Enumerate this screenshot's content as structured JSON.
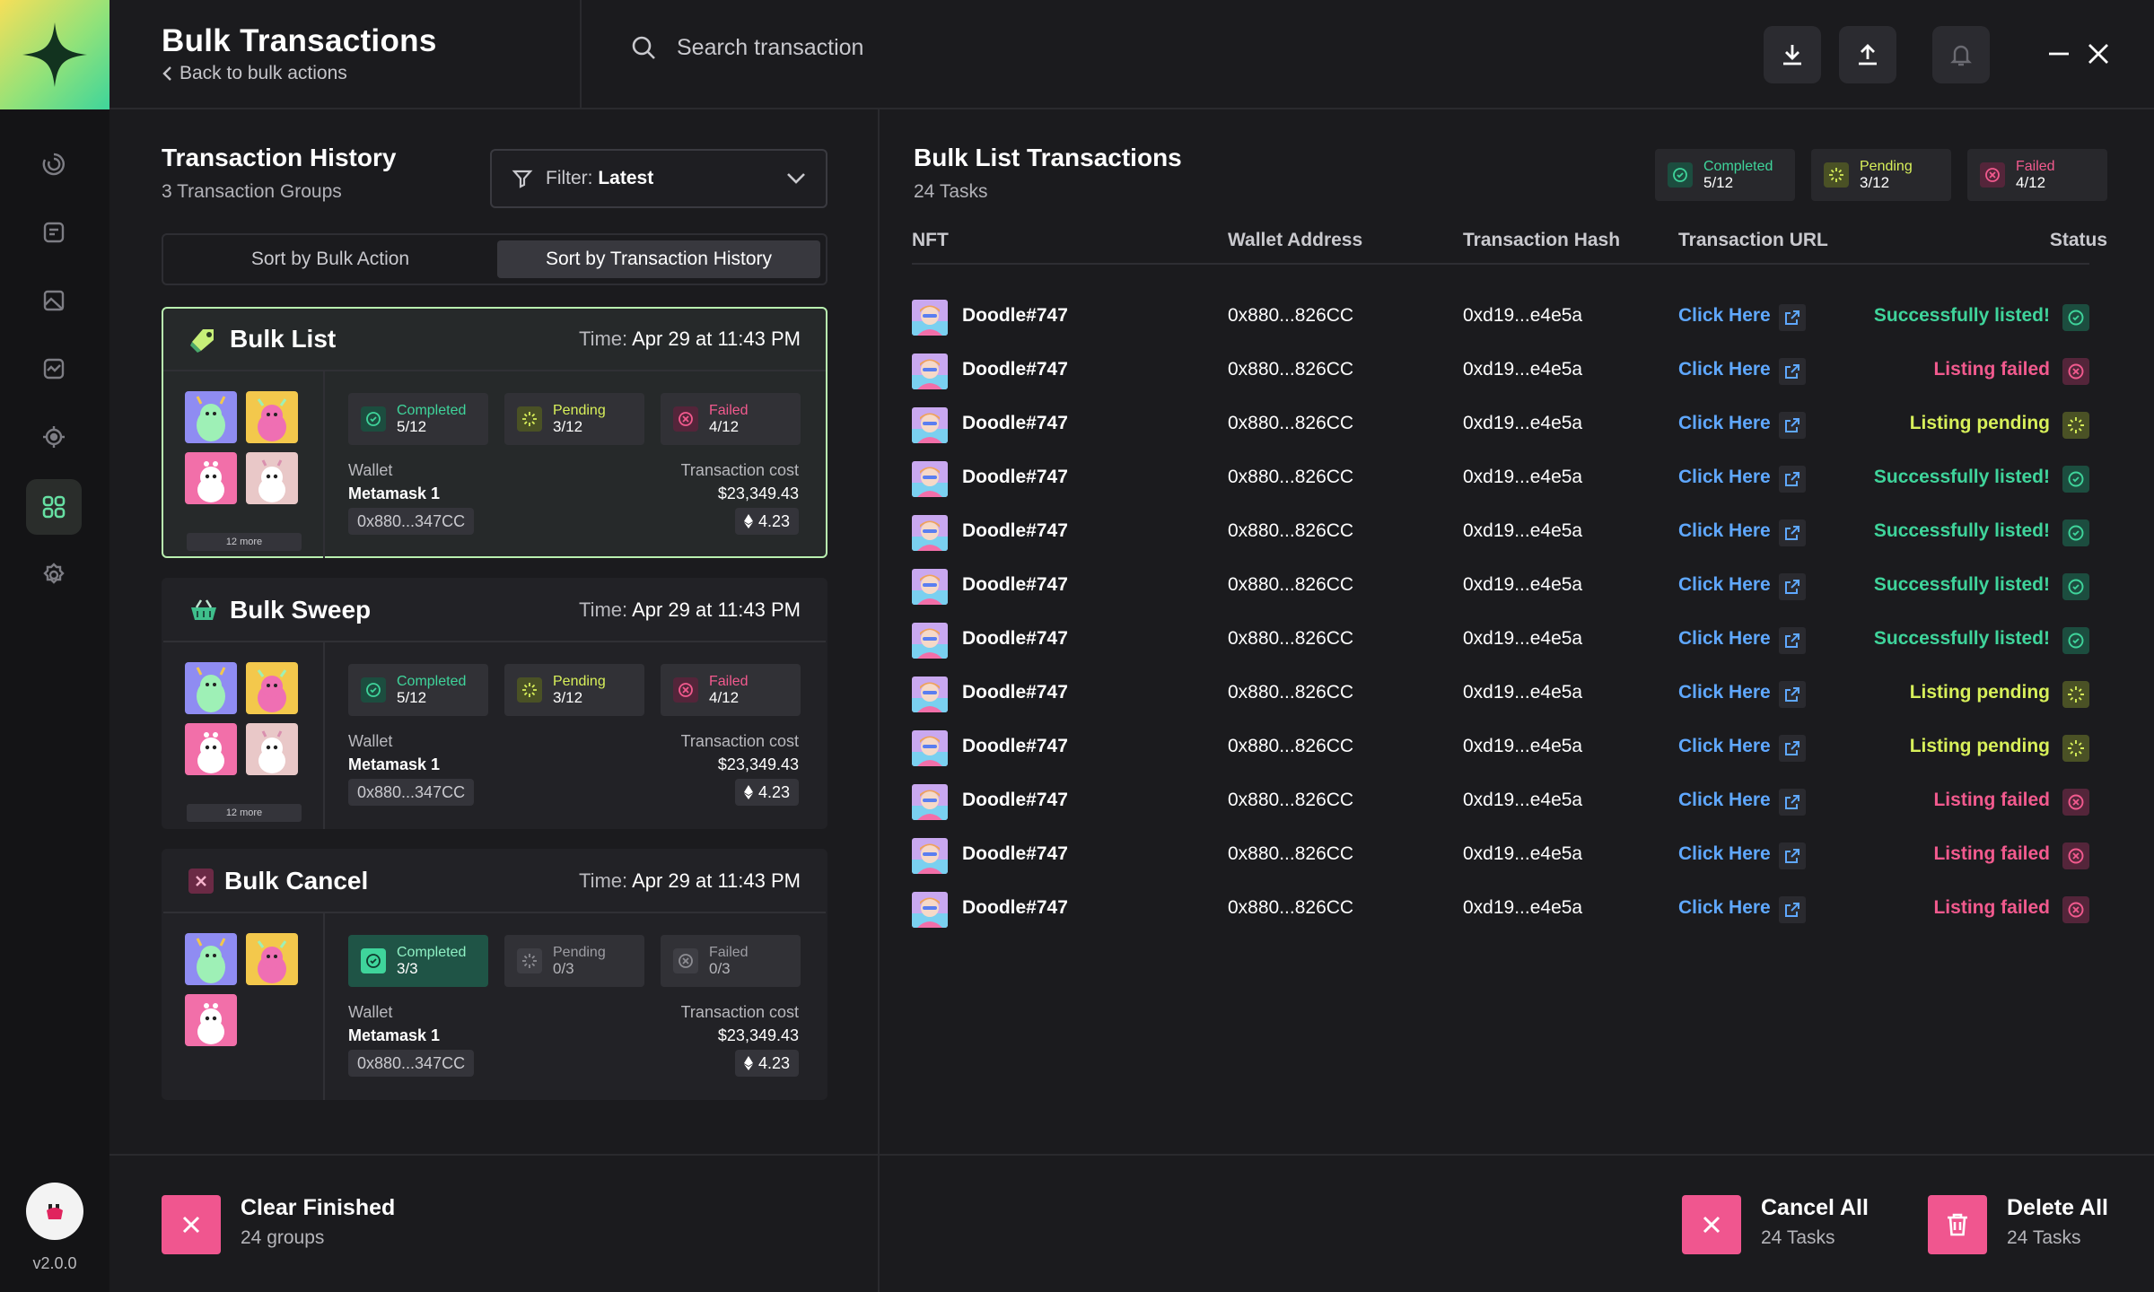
{
  "app": {
    "title": "Bulk Transactions",
    "back_label": "Back to bulk actions",
    "version": "v2.0.0"
  },
  "search": {
    "placeholder": "Search transaction"
  },
  "icons": {
    "rail": [
      "history-icon",
      "document-icon",
      "gallery-icon",
      "activity-icon",
      "target-icon",
      "grid-icon",
      "settings-icon"
    ],
    "header": [
      "download-icon",
      "upload-icon",
      "bell-icon",
      "minimize-icon",
      "close-icon"
    ]
  },
  "colors": {
    "completed": "#3fd49b",
    "pending": "#d8f05a",
    "failed": "#f25a8e",
    "link": "#5fa8ff",
    "accent_button": "#f0568f",
    "selected_border": "#b9f0b0"
  },
  "history": {
    "title": "Transaction History",
    "subtitle": "3 Transaction Groups",
    "filter_prefix": "Filter:",
    "filter_value": "Latest",
    "sort_tabs": [
      "Sort by Bulk Action",
      "Sort by Transaction History"
    ],
    "active_sort": 1,
    "groups": [
      {
        "title": "Bulk List",
        "time_prefix": "Time:",
        "time": "Apr 29 at 11:43 PM",
        "completed_label": "Completed",
        "completed": "5/12",
        "pending_label": "Pending",
        "pending": "3/12",
        "failed_label": "Failed",
        "failed": "4/12",
        "wallet_label": "Wallet",
        "wallet_name": "Metamask 1",
        "wallet_address": "0x880...347CC",
        "cost_label": "Transaction cost",
        "cost_usd": "$23,349.43",
        "cost_eth": "4.23",
        "more_label": "12 more"
      },
      {
        "title": "Bulk Sweep",
        "time_prefix": "Time:",
        "time": "Apr 29 at 11:43 PM",
        "completed_label": "Completed",
        "completed": "5/12",
        "pending_label": "Pending",
        "pending": "3/12",
        "failed_label": "Failed",
        "failed": "4/12",
        "wallet_label": "Wallet",
        "wallet_name": "Metamask 1",
        "wallet_address": "0x880...347CC",
        "cost_label": "Transaction cost",
        "cost_usd": "$23,349.43",
        "cost_eth": "4.23",
        "more_label": "12 more"
      },
      {
        "title": "Bulk Cancel",
        "time_prefix": "Time:",
        "time": "Apr 29 at 11:43 PM",
        "completed_label": "Completed",
        "completed": "3/3",
        "pending_label": "Pending",
        "pending": "0/3",
        "failed_label": "Failed",
        "failed": "0/3",
        "wallet_label": "Wallet",
        "wallet_name": "Metamask 1",
        "wallet_address": "0x880...347CC",
        "cost_label": "Transaction cost",
        "cost_usd": "$23,349.43",
        "cost_eth": "4.23"
      }
    ]
  },
  "bulk_list": {
    "title": "Bulk List Transactions",
    "subtitle": "24 Tasks",
    "summary": {
      "completed_label": "Completed",
      "completed": "5/12",
      "pending_label": "Pending",
      "pending": "3/12",
      "failed_label": "Failed",
      "failed": "4/12"
    },
    "columns": [
      "NFT",
      "Wallet Address",
      "Transaction Hash",
      "Transaction URL",
      "Status"
    ],
    "rows": [
      {
        "nft": "Doodle#747",
        "wallet": "0x880...826CC",
        "hash": "0xd19...e4e5a",
        "url": "Click Here",
        "status": "Successfully listed!",
        "state": "success"
      },
      {
        "nft": "Doodle#747",
        "wallet": "0x880...826CC",
        "hash": "0xd19...e4e5a",
        "url": "Click Here",
        "status": "Listing failed",
        "state": "failed"
      },
      {
        "nft": "Doodle#747",
        "wallet": "0x880...826CC",
        "hash": "0xd19...e4e5a",
        "url": "Click Here",
        "status": "Listing pending",
        "state": "pending"
      },
      {
        "nft": "Doodle#747",
        "wallet": "0x880...826CC",
        "hash": "0xd19...e4e5a",
        "url": "Click Here",
        "status": "Successfully listed!",
        "state": "success"
      },
      {
        "nft": "Doodle#747",
        "wallet": "0x880...826CC",
        "hash": "0xd19...e4e5a",
        "url": "Click Here",
        "status": "Successfully listed!",
        "state": "success"
      },
      {
        "nft": "Doodle#747",
        "wallet": "0x880...826CC",
        "hash": "0xd19...e4e5a",
        "url": "Click Here",
        "status": "Successfully listed!",
        "state": "success"
      },
      {
        "nft": "Doodle#747",
        "wallet": "0x880...826CC",
        "hash": "0xd19...e4e5a",
        "url": "Click Here",
        "status": "Successfully listed!",
        "state": "success"
      },
      {
        "nft": "Doodle#747",
        "wallet": "0x880...826CC",
        "hash": "0xd19...e4e5a",
        "url": "Click Here",
        "status": "Listing pending",
        "state": "pending"
      },
      {
        "nft": "Doodle#747",
        "wallet": "0x880...826CC",
        "hash": "0xd19...e4e5a",
        "url": "Click Here",
        "status": "Listing pending",
        "state": "pending"
      },
      {
        "nft": "Doodle#747",
        "wallet": "0x880...826CC",
        "hash": "0xd19...e4e5a",
        "url": "Click Here",
        "status": "Listing failed",
        "state": "failed"
      },
      {
        "nft": "Doodle#747",
        "wallet": "0x880...826CC",
        "hash": "0xd19...e4e5a",
        "url": "Click Here",
        "status": "Listing failed",
        "state": "failed"
      },
      {
        "nft": "Doodle#747",
        "wallet": "0x880...826CC",
        "hash": "0xd19...e4e5a",
        "url": "Click Here",
        "status": "Listing failed",
        "state": "failed"
      }
    ]
  },
  "footer": {
    "clear_label": "Clear Finished",
    "clear_sub": "24 groups",
    "cancel_label": "Cancel All",
    "cancel_sub": "24 Tasks",
    "delete_label": "Delete All",
    "delete_sub": "24 Tasks"
  }
}
